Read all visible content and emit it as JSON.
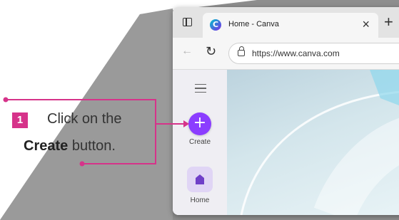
{
  "browser": {
    "tab_title": "Home - Canva",
    "favicon_letter": "C",
    "tab_close": "×",
    "new_tab": "+",
    "url": "https://www.canva.com",
    "back_glyph": "←",
    "reload_glyph": "↻"
  },
  "sidebar": {
    "create_glyph": "+",
    "create_label": "Create",
    "home_label": "Home"
  },
  "callout": {
    "step_number": "1",
    "line1": "Click on the",
    "line2_bold": "Create",
    "line2_rest": " button."
  },
  "colors": {
    "accent": "#d6338a",
    "canva_purple": "#8b3dff",
    "background_shape": "#8e8e8e"
  },
  "icons": {
    "window": "window-icon",
    "favicon": "canva-favicon-icon",
    "lock": "lock-icon",
    "hamburger": "hamburger-menu-icon",
    "create": "plus-icon",
    "home": "home-icon"
  }
}
